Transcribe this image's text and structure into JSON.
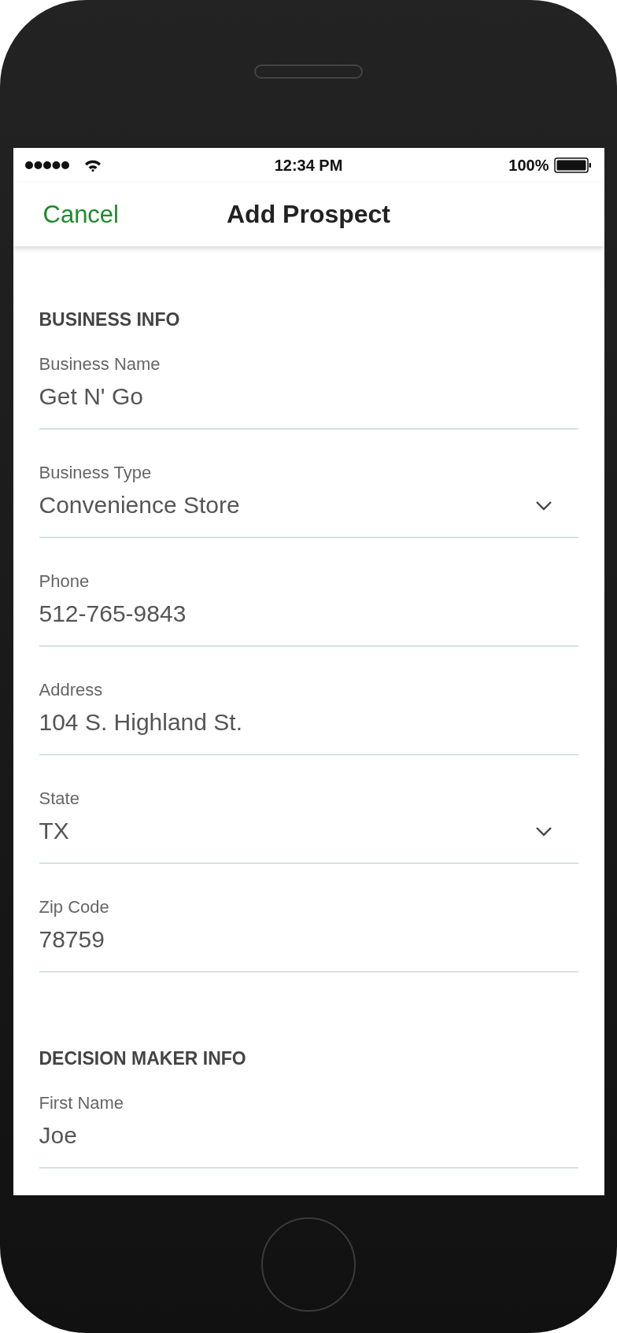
{
  "status_bar": {
    "time": "12:34 PM",
    "battery": "100%"
  },
  "nav_bar": {
    "cancel": "Cancel",
    "title": "Add Prospect"
  },
  "sections": [
    {
      "title": "BUSINESS INFO",
      "fields": [
        {
          "label": "Business Name",
          "value": "Get N' Go",
          "kind": "text"
        },
        {
          "label": "Business Type",
          "value": "Convenience Store",
          "kind": "select"
        },
        {
          "label": "Phone",
          "value": "512-765-9843",
          "kind": "text"
        },
        {
          "label": "Address",
          "value": "104 S. Highland St.",
          "kind": "text"
        },
        {
          "label": "State",
          "value": "TX",
          "kind": "select"
        },
        {
          "label": "Zip Code",
          "value": "78759",
          "kind": "text"
        }
      ]
    },
    {
      "title": "DECISION MAKER INFO",
      "fields": [
        {
          "label": "First Name",
          "value": "Joe",
          "kind": "text"
        }
      ]
    }
  ]
}
